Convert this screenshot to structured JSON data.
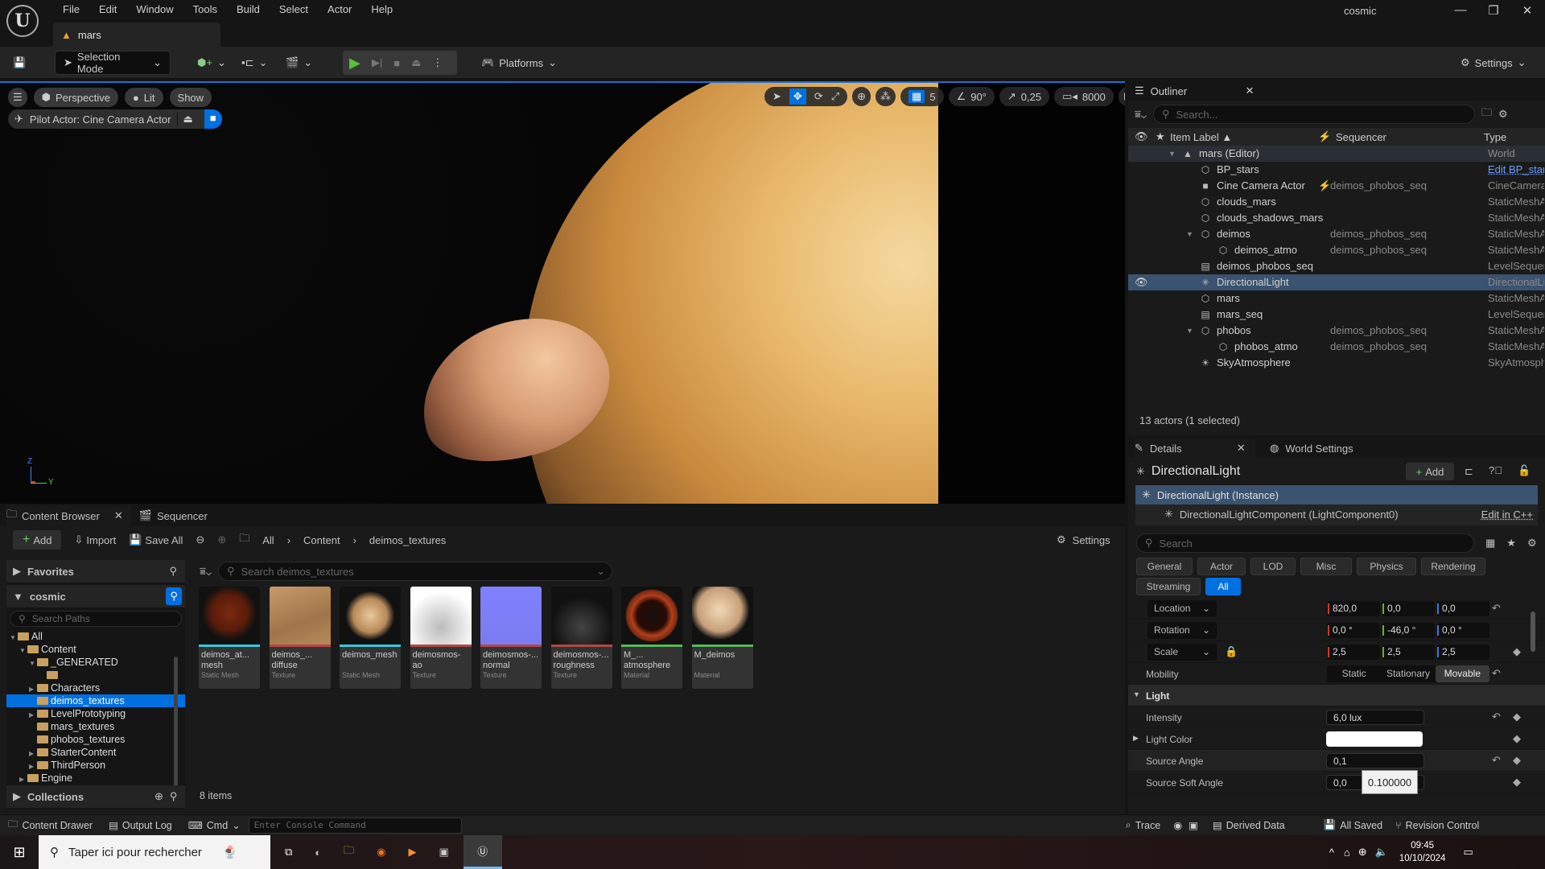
{
  "app": {
    "project": "cosmic",
    "level_tab": "mars",
    "menu": [
      "File",
      "Edit",
      "Window",
      "Tools",
      "Build",
      "Select",
      "Actor",
      "Help"
    ]
  },
  "toolbar": {
    "selection_mode": "Selection Mode",
    "platforms": "Platforms",
    "settings": "Settings"
  },
  "viewport": {
    "perspective": "Perspective",
    "lit": "Lit",
    "show": "Show",
    "pilot": "Pilot Actor: Cine Camera Actor",
    "grid_snap": "5",
    "angle_snap": "90°",
    "scale_snap": "0,25",
    "camera_speed": "8000",
    "axis_z": "Z",
    "axis_y": "Y"
  },
  "outliner": {
    "title": "Outliner",
    "search_placeholder": "Search...",
    "col_label": "Item Label ▲",
    "col_sequencer": "Sequencer",
    "col_type": "Type",
    "status": "13 actors (1 selected)",
    "rows": [
      {
        "label": "mars (Editor)",
        "indent": 0,
        "icon": "▲",
        "seq": "",
        "type": "World",
        "expand": "▼",
        "sel": false,
        "world": true
      },
      {
        "label": "BP_stars",
        "indent": 1,
        "icon": "⬡",
        "seq": "",
        "type": "Edit BP_stars",
        "link": true
      },
      {
        "label": "Cine Camera Actor",
        "indent": 1,
        "icon": "■",
        "seq": "deimos_phobos_seq",
        "type": "CineCameraActor",
        "bolt": true
      },
      {
        "label": "clouds_mars",
        "indent": 1,
        "icon": "⬡",
        "seq": "",
        "type": "StaticMeshActor"
      },
      {
        "label": "clouds_shadows_mars",
        "indent": 1,
        "icon": "⬡",
        "seq": "",
        "type": "StaticMeshActor"
      },
      {
        "label": "deimos",
        "indent": 1,
        "icon": "⬡",
        "seq": "deimos_phobos_seq",
        "type": "StaticMeshActor",
        "expand": "▼"
      },
      {
        "label": "deimos_atmo",
        "indent": 2,
        "icon": "⬡",
        "seq": "deimos_phobos_seq",
        "type": "StaticMeshActor"
      },
      {
        "label": "deimos_phobos_seq",
        "indent": 1,
        "icon": "▤",
        "seq": "",
        "type": "LevelSequenceActor"
      },
      {
        "label": "DirectionalLight",
        "indent": 1,
        "icon": "✳",
        "seq": "",
        "type": "DirectionalLight",
        "sel": true
      },
      {
        "label": "mars",
        "indent": 1,
        "icon": "⬡",
        "seq": "",
        "type": "StaticMeshActor"
      },
      {
        "label": "mars_seq",
        "indent": 1,
        "icon": "▤",
        "seq": "",
        "type": "LevelSequenceActor"
      },
      {
        "label": "phobos",
        "indent": 1,
        "icon": "⬡",
        "seq": "deimos_phobos_seq",
        "type": "StaticMeshActor",
        "expand": "▼"
      },
      {
        "label": "phobos_atmo",
        "indent": 2,
        "icon": "⬡",
        "seq": "deimos_phobos_seq",
        "type": "StaticMeshActor"
      },
      {
        "label": "SkyAtmosphere",
        "indent": 1,
        "icon": "☀",
        "seq": "",
        "type": "SkyAtmosphere"
      }
    ]
  },
  "details": {
    "tab": "Details",
    "world_tab": "World Settings",
    "actor": "DirectionalLight",
    "add": "Add",
    "instance": "DirectionalLight (Instance)",
    "component": "DirectionalLightComponent (LightComponent0)",
    "edit_cpp": "Edit in C++",
    "search_placeholder": "Search",
    "filters": [
      "General",
      "Actor",
      "LOD",
      "Misc",
      "Physics",
      "Rendering",
      "Streaming",
      "All"
    ],
    "location": {
      "label": "Location",
      "x": "820,0",
      "y": "0,0",
      "z": "0,0"
    },
    "rotation": {
      "label": "Rotation",
      "x": "0,0 °",
      "y": "-46,0 °",
      "z": "0,0 °"
    },
    "scale": {
      "label": "Scale",
      "x": "2,5",
      "y": "2,5",
      "z": "2,5"
    },
    "mobility": {
      "label": "Mobility",
      "options": [
        "Static",
        "Stationary",
        "Movable"
      ],
      "selected": "Movable"
    },
    "light_section": "Light",
    "intensity": {
      "label": "Intensity",
      "value": "6,0 lux"
    },
    "light_color": {
      "label": "Light Color",
      "value": "#ffffff"
    },
    "source_angle": {
      "label": "Source Angle",
      "value": "0,1"
    },
    "source_soft_angle": {
      "label": "Source Soft Angle",
      "value": "0,0"
    },
    "tooltip": "0.100000"
  },
  "content_browser": {
    "tab": "Content Browser",
    "sequencer_tab": "Sequencer",
    "add": "Add",
    "import": "Import",
    "save_all": "Save All",
    "breadcrumb": [
      "All",
      "Content",
      "deimos_textures"
    ],
    "settings": "Settings",
    "favorites": "Favorites",
    "project": "cosmic",
    "search_paths": "Search Paths",
    "search_assets": "Search deimos_textures",
    "collections": "Collections",
    "item_count": "8 items",
    "tree": [
      {
        "label": "All",
        "indent": 0,
        "arrow": "▼"
      },
      {
        "label": "Content",
        "indent": 1,
        "arrow": "▼"
      },
      {
        "label": "_GENERATED",
        "indent": 2,
        "arrow": "▼"
      },
      {
        "label": "",
        "indent": 3,
        "arrow": ""
      },
      {
        "label": "Characters",
        "indent": 2,
        "arrow": "▶"
      },
      {
        "label": "deimos_textures",
        "indent": 2,
        "arrow": "",
        "sel": true
      },
      {
        "label": "LevelPrototyping",
        "indent": 2,
        "arrow": "▶"
      },
      {
        "label": "mars_textures",
        "indent": 2,
        "arrow": ""
      },
      {
        "label": "phobos_textures",
        "indent": 2,
        "arrow": ""
      },
      {
        "label": "StarterContent",
        "indent": 2,
        "arrow": "▶"
      },
      {
        "label": "ThirdPerson",
        "indent": 2,
        "arrow": "▶"
      },
      {
        "label": "Engine",
        "indent": 1,
        "arrow": "▶"
      }
    ],
    "assets": [
      {
        "name": "deimos_at... mesh",
        "type": "Static Mesh",
        "bar": "#3ac8d8",
        "bg": "radial-gradient(circle at 50% 45%,#7a2a10 0%,#5a1c0a 40%,#111 62%)"
      },
      {
        "name": "deimos_... diffuse",
        "type": "Texture",
        "bar": "#b04848",
        "bg": "linear-gradient(160deg,#c69a6a,#a0754a 60%,#b88858)"
      },
      {
        "name": "deimos_mesh",
        "type": "Static Mesh",
        "bar": "#3ac8d8",
        "bg": "radial-gradient(circle at 50% 50%,#e8c89a 0%,#b8895a 40%,#111 58%)"
      },
      {
        "name": "deimosmos-ao",
        "type": "Texture",
        "bar": "#b04848",
        "bg": "radial-gradient(circle at 50% 70%,#bbb,#fff 70%)"
      },
      {
        "name": "deimosmos-... normal",
        "type": "Texture",
        "bar": "#b04848",
        "bg": "linear-gradient(#8080ff,#7c7cf0)"
      },
      {
        "name": "deimosmos-... roughness",
        "type": "Texture",
        "bar": "#b04848",
        "bg": "radial-gradient(circle at 50% 70%,#444,#111 60%)"
      },
      {
        "name": "M_... atmosphere",
        "type": "Material",
        "bar": "#5ab85a",
        "bg": "radial-gradient(circle,#111 0%,#2a0a05 35%,#b0401a 48%,#7a2a10 60%,#111 63%)"
      },
      {
        "name": "M_deimos",
        "type": "Material",
        "bar": "#5ab85a",
        "bg": "radial-gradient(circle at 45% 40%,#f0d8b8 0%,#c8a07a 45%,#111 62%)"
      }
    ]
  },
  "status": {
    "content_drawer": "Content Drawer",
    "output_log": "Output Log",
    "cmd": "Cmd",
    "console_placeholder": "Enter Console Command",
    "trace": "Trace",
    "derived_data": "Derived Data",
    "all_saved": "All Saved",
    "revision_control": "Revision Control"
  },
  "taskbar": {
    "search": "Taper ici pour rechercher",
    "time": "09:45",
    "date": "10/10/2024"
  }
}
